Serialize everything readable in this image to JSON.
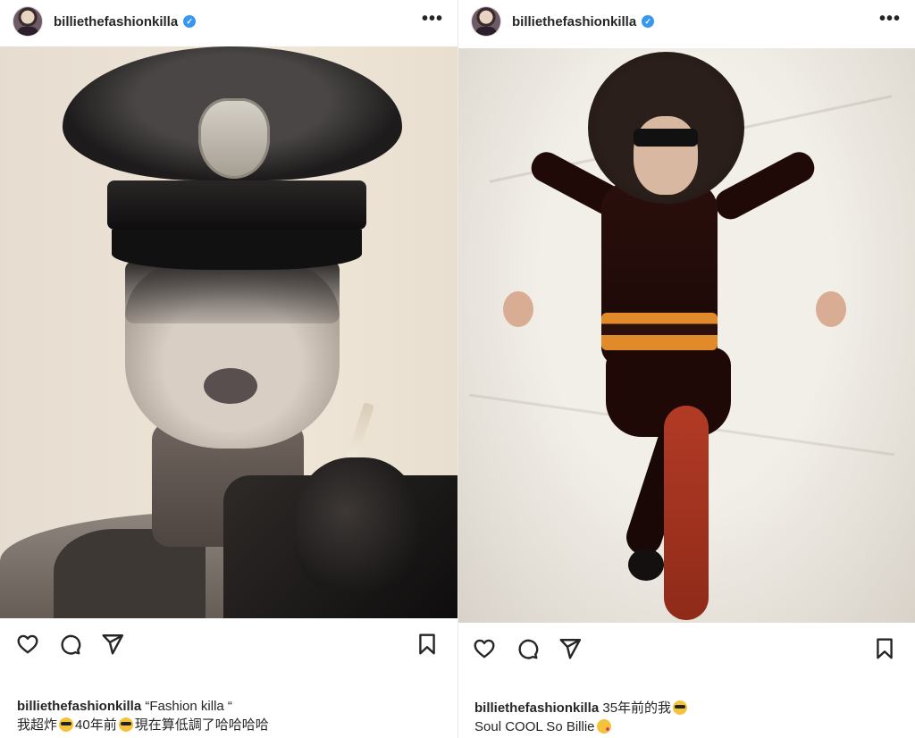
{
  "posts": [
    {
      "username": "billiethefashionkilla",
      "verified_mark": "✓",
      "more_icon": "•••",
      "caption_user": "billiethefashionkilla",
      "caption_line1": "“Fashion killa “",
      "caption_line2_a": "我超炸",
      "caption_line2_b": "40年前",
      "caption_line2_c": "現在算低調了哈哈哈哈"
    },
    {
      "username": "billiethefashionkilla",
      "verified_mark": "✓",
      "more_icon": "•••",
      "caption_user": "billiethefashionkilla",
      "caption_line1": "35年前的我",
      "caption_line2_a": "Soul COOL So Billie"
    }
  ],
  "icons": [
    "heart-icon",
    "comment-icon",
    "share-icon",
    "bookmark-icon",
    "verified-badge-icon",
    "more-options-icon"
  ],
  "colors": {
    "verified": "#3897f0",
    "text": "#262626",
    "belt": "#e08a2a",
    "stockings": "#b23b25"
  }
}
